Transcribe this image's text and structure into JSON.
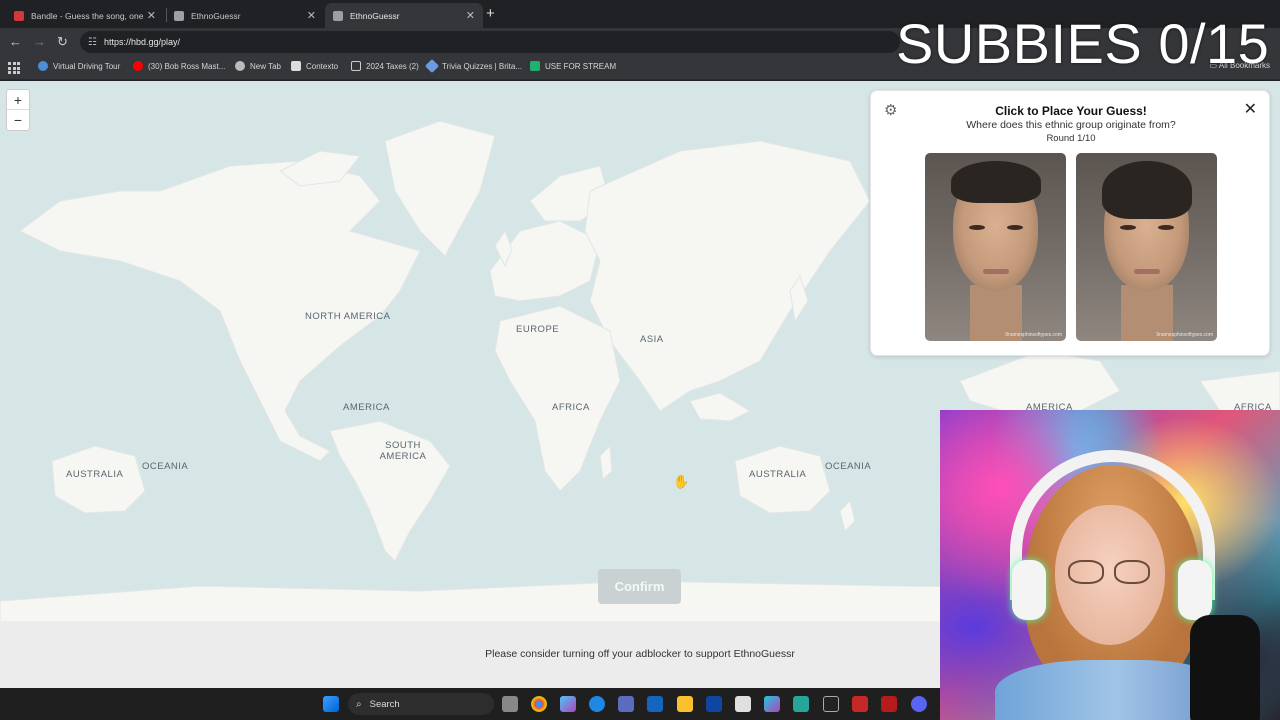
{
  "browser": {
    "tabs": [
      {
        "title": "Bandle - Guess the song, one i",
        "favicon_color": "#d23a3a",
        "active": false
      },
      {
        "title": "EthnoGuessr",
        "favicon_color": "#9aa0a6",
        "active": false
      },
      {
        "title": "EthnoGuessr",
        "favicon_color": "#9aa0a6",
        "active": true
      }
    ],
    "new_tab_symbol": "+",
    "url": "https://hbd.gg/play/",
    "bookmarks": [
      {
        "label": "Virtual Driving Tour",
        "icon": "globe-icon",
        "color": "#4a8fd8"
      },
      {
        "label": "(30) Bob Ross Mast...",
        "icon": "youtube-icon",
        "color": "#ff0000"
      },
      {
        "label": "New Tab",
        "icon": "chrome-icon",
        "color": "#bbbbbb"
      },
      {
        "label": "Contexto",
        "icon": "contexto-icon",
        "color": "#dddddd"
      },
      {
        "label": "2024 Taxes (2)",
        "icon": "folder-icon",
        "color": "#cccccc"
      },
      {
        "label": "Trivia Quizzes | Brita...",
        "icon": "britannica-icon",
        "color": "#6a9ae0"
      },
      {
        "label": "USE FOR STREAM",
        "icon": "p-icon",
        "color": "#20b070"
      }
    ],
    "all_bookmarks": "All Bookmarks"
  },
  "map": {
    "labels": [
      "NORTH AMERICA",
      "EUROPE",
      "ASIA",
      "AMERICA",
      "AFRICA",
      "SOUTH AMERICA",
      "AUSTRALIA",
      "OCEANIA",
      "AUSTRALIA",
      "OCEANIA",
      "AMERICA",
      "AFRICA"
    ],
    "zoom_in": "+",
    "zoom_out": "−",
    "confirm": "Confirm"
  },
  "panel": {
    "title": "Click to Place Your Guess!",
    "question": "Where does this ethnic group originate from?",
    "round": "Round 1/10",
    "watermark": "9namesphinsoftypes.com"
  },
  "adblock_message": "Please consider turning off your adblocker to support EthnoGuessr",
  "taskbar": {
    "search_placeholder": "Search"
  },
  "overlay": {
    "subbies": "SUBBIES 0/15"
  },
  "colors": {
    "ocean": "#d6e5e6",
    "land": "#f6f6f3",
    "confirm_disabled": "#c9d1d2"
  }
}
